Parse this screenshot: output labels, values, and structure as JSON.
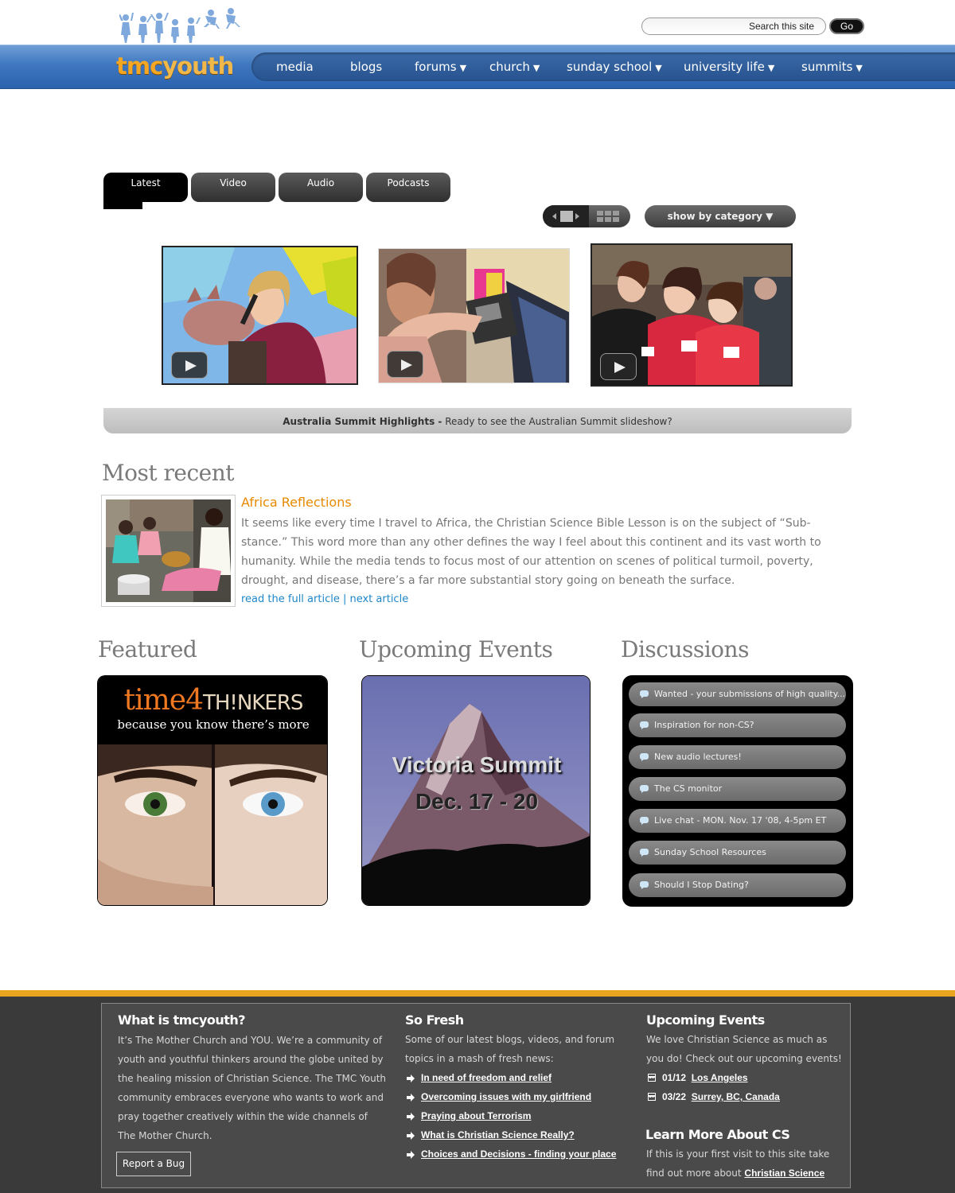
{
  "header": {
    "search_placeholder": "Search this site",
    "go_label": "Go",
    "brand_part1": "tmc",
    "brand_part2": "youth",
    "nav": [
      {
        "label": "media",
        "has_menu": false
      },
      {
        "label": "blogs",
        "has_menu": false
      },
      {
        "label": "forums",
        "has_menu": true
      },
      {
        "label": "church",
        "has_menu": true
      },
      {
        "label": "sunday school",
        "has_menu": true
      },
      {
        "label": "university life",
        "has_menu": true
      },
      {
        "label": "summits",
        "has_menu": true
      }
    ]
  },
  "media": {
    "tabs": [
      "Latest",
      "Video",
      "Audio",
      "Podcasts"
    ],
    "active_tab": "Latest",
    "category_button": "show by category ▼",
    "caption_title": "Australia Summit Highlights -",
    "caption_text": " Ready to see the Australian Summit slideshow?"
  },
  "most_recent": {
    "heading": "Most recent",
    "title": "Africa Reflections",
    "body": "It seems like every time I travel to Africa, the Christian Science Bible Lesson is on the subject of “Sub-stance.” This word more than any other defines the way I feel about this continent and its vast worth to humanity. While the media tends to focus most of our attention on scenes of political turmoil, poverty, drought, and disease, there’s a far more substantial story going on beneath the surface.",
    "read_link": "read the full article",
    "separator": " | ",
    "next_link": "next article"
  },
  "columns": {
    "featured_heading": "Featured",
    "featured_title_a": "time",
    "featured_title_b": "4",
    "featured_title_c": "TH!NKERS",
    "featured_tagline": "because you know there’s more",
    "events_heading": "Upcoming Events",
    "event_name": "Victoria Summit",
    "event_dates": "Dec. 17 - 20",
    "discussions_heading": "Discussions",
    "discussions": [
      "Wanted - your submissions of high quality...",
      "Inspiration for non-CS?",
      "New audio lectures!",
      "The CS monitor",
      "Live chat - MON. Nov. 17 '08, 4-5pm ET",
      "Sunday School Resources",
      "Should I Stop Dating?"
    ]
  },
  "footer": {
    "what_heading": "What is tmcyouth?",
    "what_text": "It’s The Mother Church and YOU. We’re a community of youth and youthful thinkers around the globe united by the healing mission of Christian Science. The TMC Youth community embraces everyone who wants to work and pray together creatively within the wide channels of The Mother Church.",
    "report_bug": "Report a Bug",
    "fresh_heading": "So Fresh",
    "fresh_text": "Some of our latest blogs, videos, and forum topics in a mash of fresh news:",
    "fresh_links": [
      "In need of freedom and relief",
      "Overcoming issues with my girlfriend",
      "Praying about Terrorism",
      "What is Christian Science Really?",
      "Choices and Decisions - finding your place "
    ],
    "events_heading": "Upcoming Events",
    "events_text": "We love Christian Science as much as you do! Check out our upcoming events!",
    "events": [
      {
        "date": "01/12",
        "place": "Los Angeles"
      },
      {
        "date": "03/22",
        "place": "Surrey, BC, Canada"
      }
    ],
    "learn_heading": "Learn More About CS",
    "learn_text": "If this is your first visit to this site take find out more about ",
    "learn_link": "Christian Science"
  },
  "colors": {
    "nav_blue": "#3f77bf",
    "brand_orange": "#f5a623",
    "link_blue": "#1f86c8",
    "title_orange": "#e88a00",
    "footer_stripe": "#e8a51d"
  }
}
